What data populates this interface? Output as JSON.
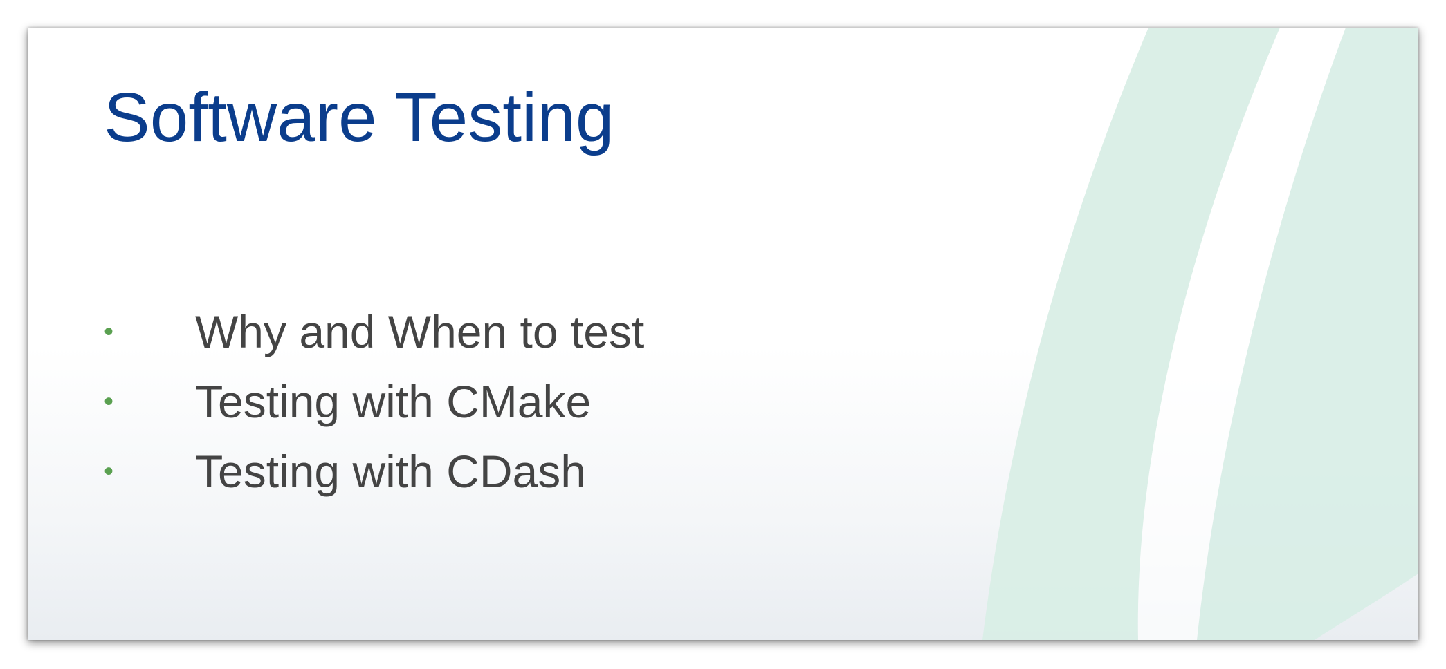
{
  "slide": {
    "title": "Software Testing",
    "bullets": [
      "Why and When to test",
      "Testing with CMake",
      "Testing with CDash"
    ],
    "bullet_glyph": "•"
  },
  "colors": {
    "title": "#0b3d8c",
    "body_text": "#444444",
    "bullet": "#5aa050",
    "accent_band": "#d4ece4"
  }
}
